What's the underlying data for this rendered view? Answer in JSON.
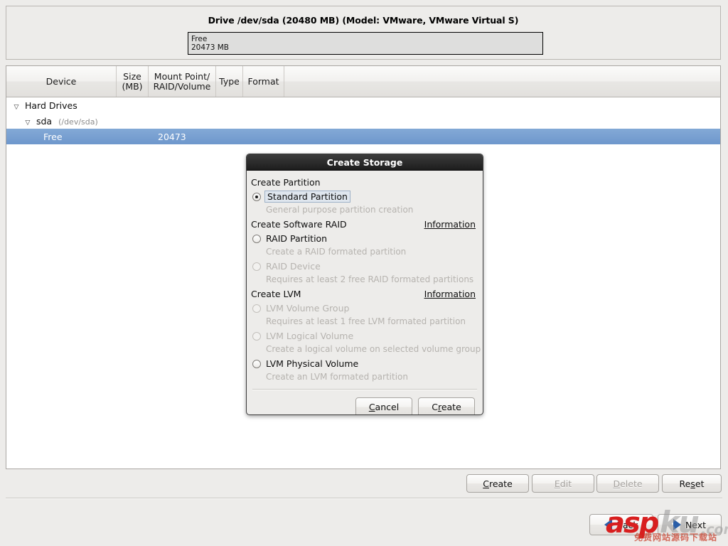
{
  "drive_panel": {
    "title": "Drive /dev/sda (20480 MB) (Model: VMware, VMware Virtual S)",
    "segment_label": "Free",
    "segment_size": "20473 MB"
  },
  "device_table": {
    "columns": {
      "device": "Device",
      "size_l1": "Size",
      "size_l2": "(MB)",
      "mount_l1": "Mount Point/",
      "mount_l2": "RAID/Volume",
      "type": "Type",
      "format": "Format"
    },
    "rows": [
      {
        "twisty": "▽",
        "name": "Hard Drives",
        "path": "",
        "size": "",
        "level": 1,
        "selected": false
      },
      {
        "twisty": "▽",
        "name": "sda",
        "path": "(/dev/sda)",
        "size": "",
        "level": 2,
        "selected": false
      },
      {
        "twisty": "",
        "name": "Free",
        "path": "",
        "size": "20473",
        "level": 3,
        "selected": true
      }
    ]
  },
  "actions": {
    "create": {
      "pre": "",
      "mnemonic": "C",
      "post": "reate",
      "disabled": false
    },
    "edit": {
      "pre": "",
      "mnemonic": "E",
      "post": "dit",
      "disabled": true
    },
    "delete": {
      "pre": "",
      "mnemonic": "D",
      "post": "elete",
      "disabled": true
    },
    "reset": {
      "pre": "Re",
      "mnemonic": "s",
      "post": "et",
      "disabled": false
    }
  },
  "wizard": {
    "back_label": "Back",
    "next_label": "Next",
    "back_icon": "arrow-left-icon",
    "next_icon": "arrow-right-icon"
  },
  "watermark": {
    "brand_red": "asp",
    "brand_gray": "ku",
    "brand_tld": ".com",
    "tagline": "免费网站源码下载站",
    "accent_red": "#d81f1f"
  },
  "dialog": {
    "title": "Create Storage",
    "groups": [
      {
        "heading": "Create Partition",
        "info": null,
        "options": [
          {
            "label": "Standard Partition",
            "desc": "General purpose partition creation",
            "checked": true,
            "disabled": false,
            "focused": true
          }
        ]
      },
      {
        "heading": "Create Software RAID",
        "info": {
          "pre": "",
          "mnemonic": "I",
          "post": "nformation"
        },
        "options": [
          {
            "label": "RAID Partition",
            "desc": "Create a RAID formated partition",
            "checked": false,
            "disabled": false,
            "focused": false
          },
          {
            "label": "RAID Device",
            "desc": "Requires at least 2 free RAID formated partitions",
            "checked": false,
            "disabled": true,
            "focused": false
          }
        ]
      },
      {
        "heading": "Create LVM",
        "info": {
          "pre": "",
          "mnemonic": "I",
          "post": "nformation"
        },
        "options": [
          {
            "label": "LVM Volume Group",
            "desc": "Requires at least 1 free LVM formated partition",
            "checked": false,
            "disabled": true,
            "focused": false
          },
          {
            "label": "LVM Logical Volume",
            "desc": "Create a logical volume on selected volume group",
            "checked": false,
            "disabled": true,
            "focused": false
          },
          {
            "label": "LVM Physical Volume",
            "desc": "Create an LVM formated partition",
            "checked": false,
            "disabled": false,
            "focused": false
          }
        ]
      }
    ],
    "buttons": {
      "cancel": {
        "pre": "",
        "mnemonic": "C",
        "post": "ancel"
      },
      "create": {
        "pre": "C",
        "mnemonic": "r",
        "post": "eate"
      }
    }
  }
}
